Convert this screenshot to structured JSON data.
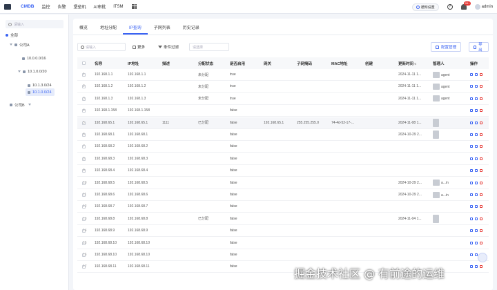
{
  "topbar": {
    "brand": "CMDB",
    "nav": [
      "监控",
      "告警",
      "堡垒机",
      "AI审批",
      "ITSM"
    ],
    "settings_pill": "通知设置",
    "help": "?",
    "badge": "99+",
    "user": "admin"
  },
  "sidebar": {
    "search_placeholder": "请输入",
    "tree": [
      {
        "label": "全部",
        "level": 0
      },
      {
        "label": "公司A",
        "level": 1
      },
      {
        "label": "10.0.0.0/16",
        "level": 2
      },
      {
        "label": "10.1.0.0/20",
        "level": 2
      },
      {
        "label": "10.1.3.0/24",
        "level": 3
      },
      {
        "label": "10.1.0.0/24",
        "level": 3,
        "active": true
      },
      {
        "label": "公司B",
        "level": 1
      }
    ]
  },
  "tabs": [
    "概览",
    "地址分配",
    "IP查询",
    "子网列表",
    "历史记录"
  ],
  "active_tab": 2,
  "toolbar": {
    "search_placeholder": "请输入",
    "toggle_label": "更多",
    "filter_label": "条件过滤",
    "select_placeholder": "请选择",
    "config_button": "配置管理",
    "export_button": "导出"
  },
  "table": {
    "headers": [
      "名称",
      "IP地址",
      "描述",
      "分配状态",
      "是否启用",
      "网关",
      "子网掩码",
      "MAC地址",
      "创建",
      "更新时间",
      "管理人",
      "操作"
    ],
    "rows": [
      {
        "no": "1",
        "name": "192.168.1.1",
        "ip": "192.168.1.1",
        "desc": "",
        "status": "未分配",
        "enabled": "true",
        "gw": "",
        "mask": "",
        "mac": "",
        "created": "",
        "updated": "2024-11-11 1...",
        "owner": "agent"
      },
      {
        "no": "2",
        "name": "192.168.1.2",
        "ip": "192.168.1.2",
        "desc": "",
        "status": "未分配",
        "enabled": "true",
        "gw": "",
        "mask": "",
        "mac": "",
        "created": "",
        "updated": "2024-11-11 1...",
        "owner": "agent"
      },
      {
        "no": "3",
        "name": "192.168.1.3",
        "ip": "192.168.1.3",
        "desc": "",
        "status": "未分配",
        "enabled": "true",
        "gw": "",
        "mask": "",
        "mac": "",
        "created": "",
        "updated": "2024-11-11 1...",
        "owner": "agent"
      },
      {
        "no": "4",
        "name": "192.168.1.158",
        "ip": "192.168.1.158",
        "desc": "",
        "status": "",
        "enabled": "false",
        "gw": "",
        "mask": "",
        "mac": "",
        "created": "",
        "updated": "",
        "owner": ""
      },
      {
        "no": "5",
        "name": "192.168.65.1",
        "ip": "192.168.65.1",
        "desc": "1111",
        "status": "已分配",
        "enabled": "false",
        "gw": "192.168.65.1",
        "mask": "255.255.255.0",
        "mac": "74-4d-52-17-...",
        "created": "",
        "updated": "2024-11-08 1...",
        "owner": ""
      },
      {
        "no": "6",
        "name": "192.168.68.1",
        "ip": "192.168.68.1",
        "desc": "",
        "status": "",
        "enabled": "false",
        "gw": "",
        "mask": "",
        "mac": "",
        "created": "",
        "updated": "2024-10-29 2...",
        "owner": ""
      },
      {
        "no": "7",
        "name": "192.168.68.2",
        "ip": "192.168.68.2",
        "desc": "",
        "status": "",
        "enabled": "false",
        "gw": "",
        "mask": "",
        "mac": "",
        "created": "",
        "updated": "",
        "owner": ""
      },
      {
        "no": "8",
        "name": "192.168.68.3",
        "ip": "192.168.68.3",
        "desc": "",
        "status": "",
        "enabled": "false",
        "gw": "",
        "mask": "",
        "mac": "",
        "created": "",
        "updated": "",
        "owner": ""
      },
      {
        "no": "9",
        "name": "192.168.68.4",
        "ip": "192.168.68.4",
        "desc": "",
        "status": "",
        "enabled": "false",
        "gw": "",
        "mask": "",
        "mac": "",
        "created": "",
        "updated": "",
        "owner": ""
      },
      {
        "no": "10",
        "name": "192.168.68.5",
        "ip": "192.168.68.5",
        "desc": "",
        "status": "",
        "enabled": "false",
        "gw": "",
        "mask": "",
        "mac": "",
        "created": "",
        "updated": "2024-10-29 2...",
        "owner": "a...in"
      },
      {
        "no": "11",
        "name": "192.168.68.6",
        "ip": "192.168.68.6",
        "desc": "",
        "status": "",
        "enabled": "false",
        "gw": "",
        "mask": "",
        "mac": "",
        "created": "",
        "updated": "2024-10-29 2...",
        "owner": "a...in"
      },
      {
        "no": "12",
        "name": "192.168.68.7",
        "ip": "192.168.68.7",
        "desc": "",
        "status": "",
        "enabled": "false",
        "gw": "",
        "mask": "",
        "mac": "",
        "created": "",
        "updated": "",
        "owner": ""
      },
      {
        "no": "13",
        "name": "192.168.68.8",
        "ip": "192.168.68.8",
        "desc": "",
        "status": "已分配",
        "enabled": "false",
        "gw": "",
        "mask": "",
        "mac": "",
        "created": "",
        "updated": "2024-11-04 1...",
        "owner": ""
      },
      {
        "no": "14",
        "name": "192.168.68.9",
        "ip": "192.168.68.9",
        "desc": "",
        "status": "",
        "enabled": "false",
        "gw": "",
        "mask": "",
        "mac": "",
        "created": "",
        "updated": "",
        "owner": ""
      },
      {
        "no": "15",
        "name": "192.168.68.10",
        "ip": "192.168.68.10",
        "desc": "",
        "status": "",
        "enabled": "false",
        "gw": "",
        "mask": "",
        "mac": "",
        "created": "",
        "updated": "",
        "owner": ""
      },
      {
        "no": "16",
        "name": "192.168.68.10",
        "ip": "192.168.68.10",
        "desc": "",
        "status": "",
        "enabled": "false",
        "gw": "",
        "mask": "",
        "mac": "",
        "created": "",
        "updated": "",
        "owner": ""
      },
      {
        "no": "17",
        "name": "192.168.68.11",
        "ip": "192.168.68.11",
        "desc": "",
        "status": "",
        "enabled": "false",
        "gw": "",
        "mask": "",
        "mac": "",
        "created": "",
        "updated": "",
        "owner": ""
      }
    ]
  },
  "watermark": "掘金技术社区 @ 有前途的运维",
  "colors": {
    "accent": "#3a63f3",
    "danger": "#e53935"
  }
}
